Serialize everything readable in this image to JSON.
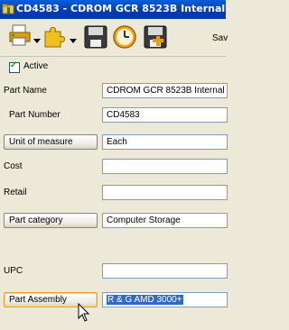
{
  "window": {
    "title": "CD4583 - CDROM GCR 8523B Internal",
    "icon": "folder-icon"
  },
  "toolbar": {
    "items": [
      {
        "name": "print-icon"
      },
      {
        "name": "puzzle-icon"
      },
      {
        "name": "save-disk-icon"
      },
      {
        "name": "clock-icon"
      },
      {
        "name": "save-new-icon"
      }
    ],
    "save_label": "Sav"
  },
  "form": {
    "active_label": "Active",
    "active_checked": true,
    "part_name_label": "Part Name",
    "part_name_value": "CDROM GCR 8523B Internal",
    "part_number_label": "Part Number",
    "part_number_value": "CD4583",
    "unit_button": "Unit of measure",
    "unit_value": "Each",
    "cost_label": "Cost",
    "cost_value": "",
    "retail_label": "Retail",
    "retail_value": "",
    "category_button": "Part category",
    "category_value": "Computer Storage",
    "upc_label": "UPC",
    "upc_value": "",
    "assembly_button": "Part Assembly",
    "assembly_value": "R & G AMD 3000+"
  },
  "colors": {
    "titlebar": "#0a5fd8",
    "selection": "#316ac5"
  }
}
